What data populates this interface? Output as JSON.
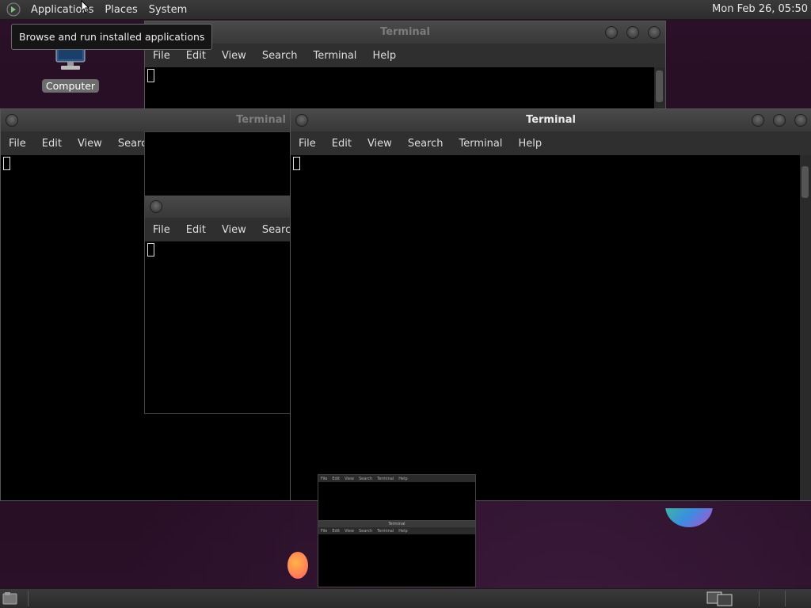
{
  "top_panel": {
    "menus": [
      "Applications",
      "Places",
      "System"
    ],
    "clock": "Mon Feb 26, 05:50"
  },
  "tooltip": "Browse and run installed applications",
  "desktop": {
    "icon_label": "Computer",
    "icon": "computer-icon"
  },
  "windows": {
    "back": {
      "title": "Terminal",
      "menu": [
        "File",
        "Edit",
        "View",
        "Search",
        "Terminal",
        "Help"
      ]
    },
    "left": {
      "title": "Terminal",
      "menu": [
        "File",
        "Edit",
        "View",
        "Searc"
      ]
    },
    "middle": {
      "menu": [
        "File",
        "Edit",
        "View",
        "Search"
      ]
    },
    "front": {
      "title": "Terminal",
      "menu": [
        "File",
        "Edit",
        "View",
        "Search",
        "Terminal",
        "Help"
      ]
    },
    "thumb_top": {
      "menu": [
        "File",
        "Edit",
        "View",
        "Search",
        "Terminal",
        "Help"
      ]
    },
    "thumb_bottom": {
      "title": "Terminal",
      "menu": [
        "File",
        "Edit",
        "View",
        "Search",
        "Terminal",
        "Help"
      ]
    }
  },
  "colors": {
    "desktop": "#200c20",
    "panel": "#333333",
    "terminal_bg": "#000000"
  }
}
